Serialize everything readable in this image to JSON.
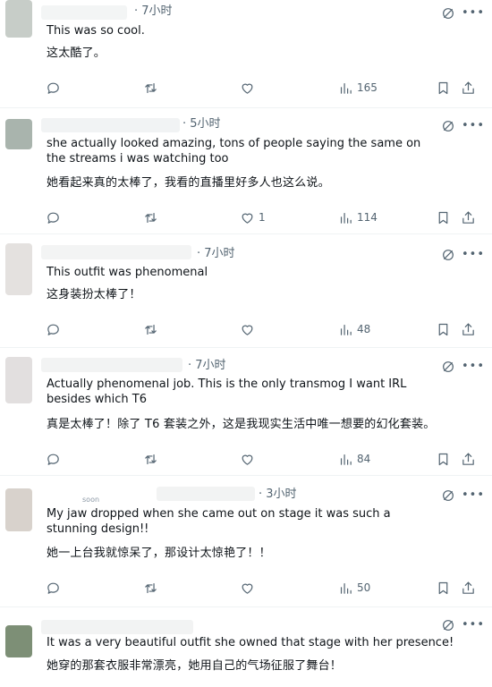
{
  "posts": [
    {
      "meta": "· 7小时",
      "text_en": "This was so cool.",
      "text_zh": "这太酷了。",
      "likes": "",
      "views": "165"
    },
    {
      "meta": "· 5小时",
      "text_en": "she actually looked amazing, tons of people saying the same on the streams i was watching too",
      "text_zh": "她看起来真的太棒了，我看的直播里好多人也这么说。",
      "likes": "1",
      "views": "114"
    },
    {
      "meta": "· 7小时",
      "text_en": "This outfit was phenomenal",
      "text_zh": "这身装扮太棒了！",
      "likes": "",
      "views": "48"
    },
    {
      "meta": "· 7小时",
      "text_en": "Actually phenomenal job. This is the only transmog I want IRL besides which T6",
      "text_zh": "真是太棒了！除了 T6 套装之外，这是我现实生活中唯一想要的幻化套装。",
      "likes": "",
      "views": "84"
    },
    {
      "meta": "· 3小时",
      "stub": "soon",
      "text_en": "My jaw dropped when she came out on stage it was such a stunning design!!",
      "text_zh": "她一上台我就惊呆了，那设计太惊艳了！！",
      "likes": "",
      "views": "50"
    },
    {
      "meta": "",
      "text_en": "It was a very beautiful outfit she owned that stage with her presence!",
      "text_zh": "她穿的那套衣服非常漂亮，她用自己的气场征服了舞台！",
      "likes": "",
      "views": ""
    }
  ],
  "icons": {
    "more": "•••",
    "reply": "reply-icon",
    "retweet": "retweet-icon",
    "like": "heart-icon",
    "views": "views-icon",
    "bookmark": "bookmark-icon",
    "share": "share-icon",
    "grok": "grok-icon"
  },
  "colors": {
    "text": "#0f1419",
    "secondary": "#536471",
    "divider": "#eff3f4"
  }
}
